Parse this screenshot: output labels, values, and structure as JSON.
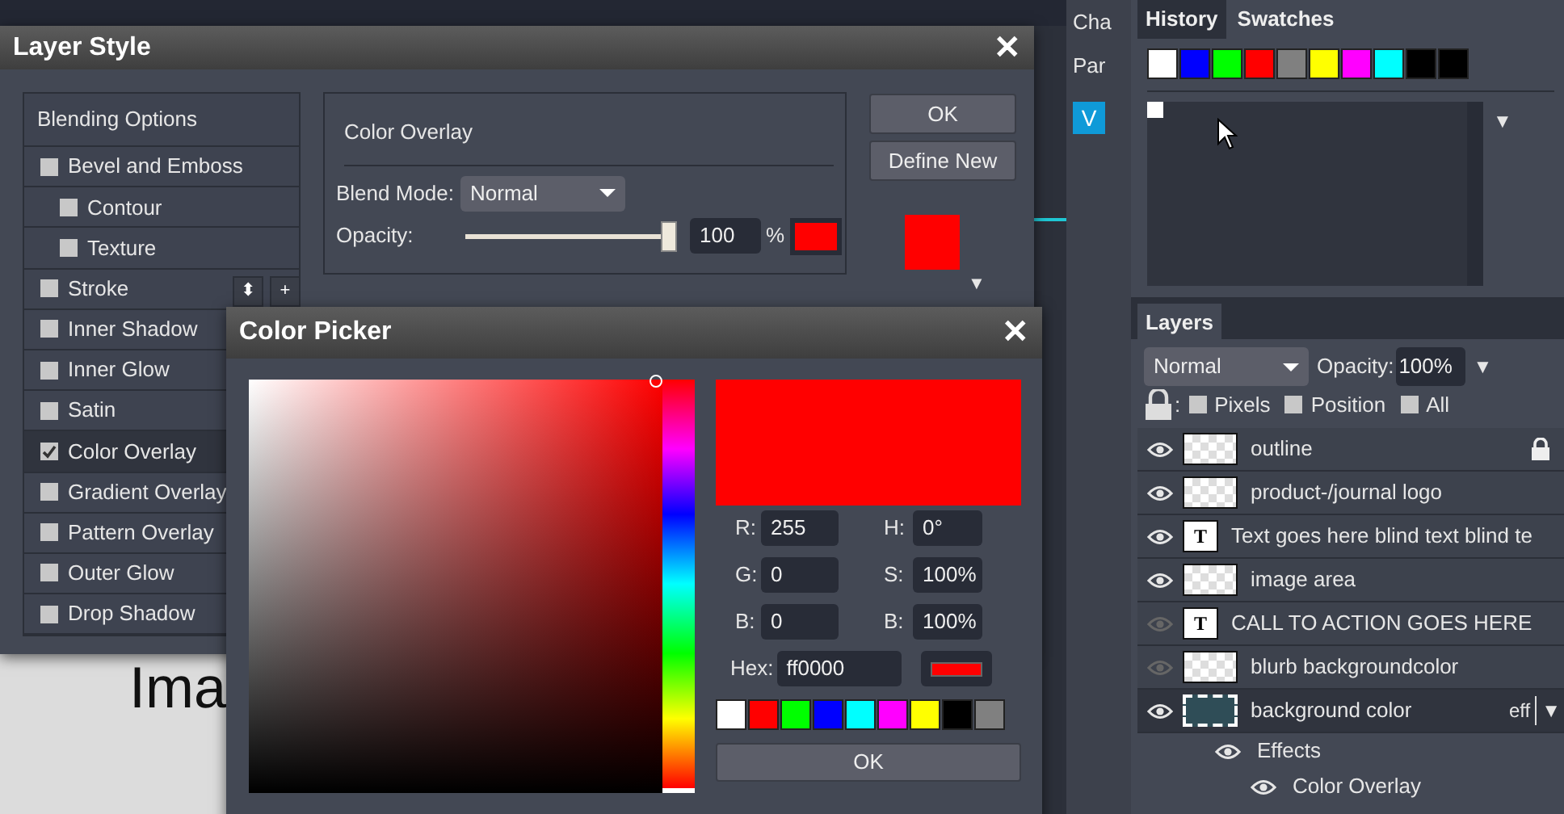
{
  "canvas": {
    "text": "Ima"
  },
  "layer_style": {
    "title": "Layer Style",
    "close": "✕",
    "options": [
      {
        "label": "Blending Options",
        "kind": "header",
        "selected": false
      },
      {
        "label": "Bevel and Emboss",
        "kind": "check",
        "checked": false,
        "selected": false
      },
      {
        "label": "Contour",
        "kind": "subcheck",
        "checked": false,
        "selected": false
      },
      {
        "label": "Texture",
        "kind": "subcheck",
        "checked": false,
        "selected": false
      },
      {
        "label": "Stroke",
        "kind": "check",
        "checked": false,
        "selected": false
      },
      {
        "label": "Inner Shadow",
        "kind": "check",
        "checked": false,
        "selected": false
      },
      {
        "label": "Inner Glow",
        "kind": "check",
        "checked": false,
        "selected": false
      },
      {
        "label": "Satin",
        "kind": "check",
        "checked": false,
        "selected": false
      },
      {
        "label": "Color Overlay",
        "kind": "check",
        "checked": true,
        "selected": true
      },
      {
        "label": "Gradient Overlay",
        "kind": "check",
        "checked": false,
        "selected": false
      },
      {
        "label": "Pattern Overlay",
        "kind": "check",
        "checked": false,
        "selected": false
      },
      {
        "label": "Outer Glow",
        "kind": "check",
        "checked": false,
        "selected": false
      },
      {
        "label": "Drop Shadow",
        "kind": "check",
        "checked": false,
        "selected": false
      }
    ],
    "stroke_buttons": [
      "⬍",
      "+"
    ],
    "section_title": "Color Overlay",
    "blend_label": "Blend Mode:",
    "blend_value": "Normal",
    "opacity_label": "Opacity:",
    "opacity": {
      "level": 0.97
    },
    "opacity_value": "100",
    "opacity_unit": "%",
    "overlay_swatch": {
      "color": "#ff0000"
    },
    "buttons": [
      "OK",
      "Define New"
    ],
    "preview": {
      "color": "#ff0000"
    },
    "menu_arrow": "▼"
  },
  "color_picker": {
    "title": "Color Picker",
    "close": "✕",
    "color": "#ff0000",
    "fields": [
      {
        "label": "R:",
        "value": "255"
      },
      {
        "label": "H:",
        "value": "0°"
      },
      {
        "label": "G:",
        "value": "0"
      },
      {
        "label": "S:",
        "value": "100%"
      },
      {
        "label": "B:",
        "value": "0"
      },
      {
        "label": "B:",
        "value": "100%"
      }
    ],
    "hex_label": "Hex:",
    "hex_value": "ff0000",
    "swatches": [
      {
        "color": "#ffffff"
      },
      {
        "color": "#ff0000"
      },
      {
        "color": "#00ff00"
      },
      {
        "color": "#0000ff"
      },
      {
        "color": "#00ffff"
      },
      {
        "color": "#ff00ff"
      },
      {
        "color": "#ffff00"
      },
      {
        "color": "#000000"
      },
      {
        "color": "#808080"
      }
    ],
    "ok": "OK"
  },
  "side_tabs": [
    "Cha",
    "Par"
  ],
  "side_button": "V",
  "swatches_panel": {
    "tabs": [
      {
        "label": "History",
        "selected": false
      },
      {
        "label": "Swatches",
        "selected": true
      }
    ],
    "swatches": [
      {
        "color": "#ffffff"
      },
      {
        "color": "#0000ff"
      },
      {
        "color": "#00ff00"
      },
      {
        "color": "#ff0000"
      },
      {
        "color": "#808080"
      },
      {
        "color": "#ffff00"
      },
      {
        "color": "#ff00ff"
      },
      {
        "color": "#00ffff"
      },
      {
        "color": "#000000"
      },
      {
        "color": "#000000"
      }
    ],
    "menu_arrow": "▼"
  },
  "layers_panel": {
    "tab": "Layers",
    "blend_value": "Normal",
    "opacity_label": "Opacity:",
    "opacity_value": "100%",
    "menu_arrow": "▼",
    "lock_colon": ":",
    "lock_options": [
      {
        "label": "Pixels",
        "checked": false
      },
      {
        "label": "Position",
        "checked": false
      },
      {
        "label": "All",
        "checked": false
      }
    ],
    "layers": [
      {
        "name": "outline",
        "kind": "checker",
        "visible": true,
        "locked": true,
        "selected": false
      },
      {
        "name": "product-/journal logo",
        "kind": "checker",
        "visible": true,
        "locked": false,
        "selected": false
      },
      {
        "name": "Text goes here blind text blind te",
        "kind": "text",
        "thumb_text": "T",
        "visible": true,
        "locked": false,
        "selected": false
      },
      {
        "name": "image area",
        "kind": "checker",
        "visible": true,
        "locked": false,
        "selected": false
      },
      {
        "name": "CALL TO ACTION GOES HERE",
        "kind": "text",
        "thumb_text": "T",
        "visible": false,
        "locked": false,
        "selected": false
      },
      {
        "name": "blurb backgroundcolor",
        "kind": "checker",
        "visible": false,
        "locked": false,
        "selected": false
      },
      {
        "name": "background color",
        "kind": "solid",
        "visible": true,
        "locked": false,
        "selected": true,
        "fx": "eff",
        "fx_arrow": "▼",
        "children": [
          {
            "name": "Effects",
            "children": [
              {
                "name": "Color Overlay"
              }
            ]
          }
        ]
      }
    ]
  }
}
